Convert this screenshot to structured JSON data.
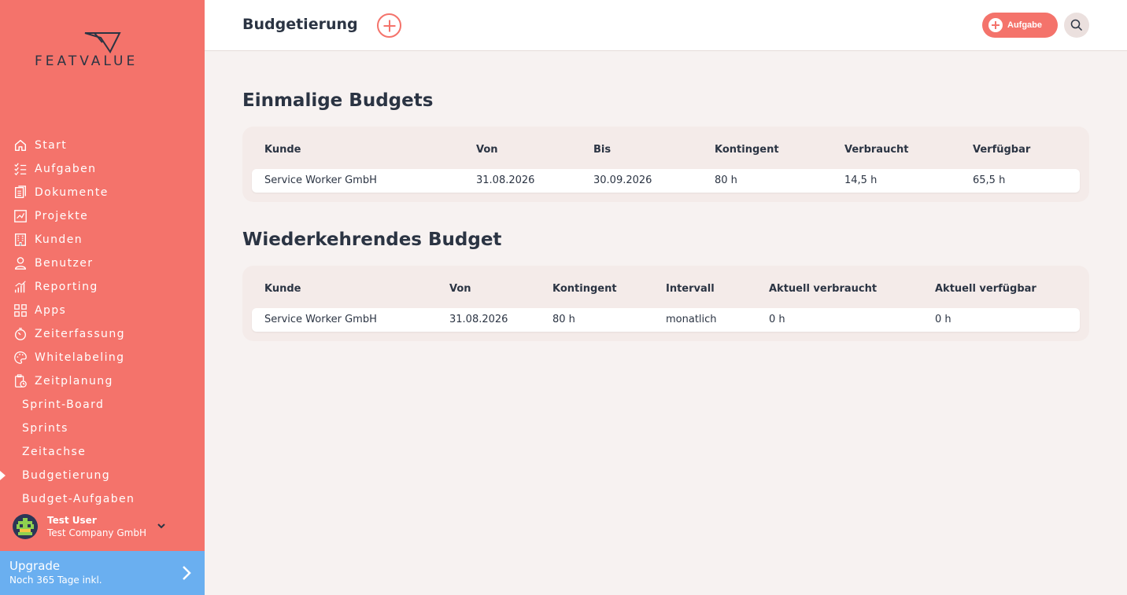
{
  "sidebar": {
    "logo_text": "FEATVALUE",
    "nav": [
      {
        "label": "Start",
        "icon": "home-icon"
      },
      {
        "label": "Aufgaben",
        "icon": "tasks-icon"
      },
      {
        "label": "Dokumente",
        "icon": "documents-icon"
      },
      {
        "label": "Projekte",
        "icon": "projects-icon"
      },
      {
        "label": "Kunden",
        "icon": "building-icon"
      },
      {
        "label": "Benutzer",
        "icon": "user-icon"
      },
      {
        "label": "Reporting",
        "icon": "reporting-icon"
      },
      {
        "label": "Apps",
        "icon": "apps-icon"
      },
      {
        "label": "Zeiterfassung",
        "icon": "stopwatch-icon"
      },
      {
        "label": "Whitelabeling",
        "icon": "palette-icon"
      },
      {
        "label": "Zeitplanung",
        "icon": "clipboard-clock-icon"
      }
    ],
    "sub_nav": [
      {
        "label": "Sprint-Board"
      },
      {
        "label": "Sprints"
      },
      {
        "label": "Zeitachse"
      },
      {
        "label": "Budgetierung",
        "active": true
      },
      {
        "label": "Budget-Aufgaben"
      }
    ],
    "user": {
      "name": "Test User",
      "company": "Test Company GmbH"
    },
    "upgrade": {
      "title": "Upgrade",
      "subtitle": "Noch 365 Tage inkl."
    }
  },
  "header": {
    "title": "Budgetierung",
    "task_button": "Aufgabe"
  },
  "one_time": {
    "title": "Einmalige Budgets",
    "columns": [
      "Kunde",
      "Von",
      "Bis",
      "Kontingent",
      "Verbraucht",
      "Verfügbar"
    ],
    "rows": [
      [
        "Service Worker GmbH",
        "31.08.2026",
        "30.09.2026",
        "80 h",
        "14,5 h",
        "65,5 h"
      ]
    ]
  },
  "recurring": {
    "title": "Wiederkehrendes Budget",
    "columns": [
      "Kunde",
      "Von",
      "Kontingent",
      "Intervall",
      "Aktuell verbraucht",
      "Aktuell verfügbar"
    ],
    "rows": [
      [
        "Service Worker GmbH",
        "31.08.2026",
        "80 h",
        "monatlich",
        "0 h",
        "0 h"
      ]
    ]
  },
  "colors": {
    "accent": "#f4736b",
    "upgrade": "#6aaff0",
    "text": "#2b3443"
  }
}
